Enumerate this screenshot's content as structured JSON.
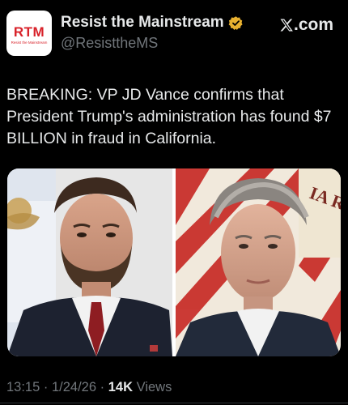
{
  "author": {
    "avatar_text": "RTM",
    "avatar_subtext": "Resist the Mainstream",
    "display_name": "Resist the Mainstream",
    "handle": "@ResisttheMS",
    "verified_badge_color": "#e8b130"
  },
  "source": {
    "icon": "x-logo-icon",
    "label": ".com"
  },
  "post": {
    "text": "BREAKING: VP JD Vance confirms that President Trump's administration has found $7 BILLION in fraud in California."
  },
  "media": {
    "left_flag_text": "",
    "right_flag_text": "IA  RE"
  },
  "meta": {
    "time": "13:15",
    "separator": "·",
    "date": "1/24/26",
    "views_count": "14K",
    "views_label": "Views"
  },
  "colors": {
    "background": "#000000",
    "primary_text": "#e7e9ea",
    "secondary_text": "#71767b",
    "brand_red": "#d8222a"
  }
}
